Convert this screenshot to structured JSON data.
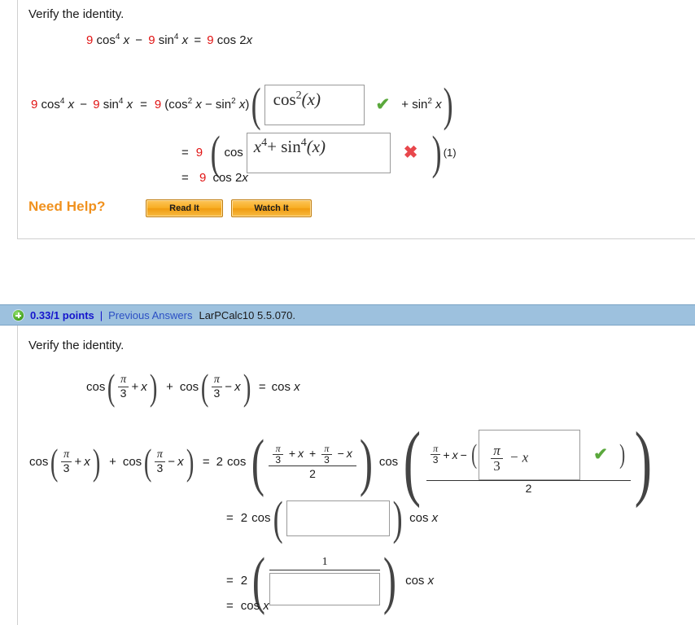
{
  "problem1": {
    "prompt": "Verify the identity.",
    "identity": {
      "coef": "9",
      "lhs_a": "cos",
      "lhs_a_sup": "4",
      "var": "x",
      "minus": "−",
      "lhs_b": "sin",
      "lhs_b_sup": "4",
      "eq": "=",
      "rhs_coef": "9",
      "rhs": "cos 2",
      "rhs_var": "x"
    },
    "line1": {
      "left": "9 cos⁴ x − 9 sin⁴ x",
      "eq": "=",
      "coef": "9",
      "factor": "(cos² x − sin² x)",
      "box_value": "cos",
      "box_sup": "2",
      "box_arg": "(x)",
      "mark": "✔",
      "mark_state": "correct",
      "tail": "+ sin² x"
    },
    "line2": {
      "eq": "=",
      "coef": "9",
      "cos_label": "cos",
      "box_var": "x",
      "box_sup1": "4",
      "box_plus": "+",
      "box_fn": "sin",
      "box_sup2": "4",
      "box_arg": "(x)",
      "mark": "✖",
      "mark_state": "incorrect",
      "tail": "(1)"
    },
    "line3": {
      "eq": "=",
      "coef": "9",
      "expr": "cos 2",
      "var": "x"
    },
    "need_help_label": "Need Help?",
    "buttons": [
      {
        "label": "Read It"
      },
      {
        "label": "Watch It"
      }
    ]
  },
  "statusbar": {
    "icon": "plus-circle-icon",
    "points": "0.33/1 points",
    "separator": "|",
    "previous_answers": "Previous Answers",
    "question_code": "LarPCalc10 5.5.070."
  },
  "problem2": {
    "prompt": "Verify the identity.",
    "identity": {
      "cos": "cos",
      "pi": "π",
      "three": "3",
      "plus": "+",
      "minus": "−",
      "var": "x",
      "eq": "=",
      "rhs": "cos x"
    },
    "work_line1": {
      "left_cos": "cos",
      "pi": "π",
      "three": "3",
      "plus": "+",
      "minus": "−",
      "var": "x",
      "eq": "=",
      "coef": "2",
      "cos": "cos",
      "frac1_num": "π/3 + x + π/3 − x",
      "frac1_den": "2",
      "frac2_den": "2",
      "box_pi": "π",
      "box_three": "3",
      "box_minus": "−",
      "box_var": "x",
      "mark": "✔",
      "mark_state": "correct"
    },
    "work_line2": {
      "eq": "=",
      "coef": "2",
      "cos": "cos",
      "box_value": "",
      "tail": "cos x"
    },
    "work_line3": {
      "eq": "=",
      "coef": "2",
      "num": "1",
      "box_value": "",
      "tail": "cos x"
    },
    "work_line4": {
      "eq": "=",
      "expr": "cos x"
    }
  },
  "colors": {
    "accent_red": "#e11414",
    "status_blue": "#9dc1de",
    "link_blue": "#2b4fc4",
    "points_blue": "#1515cc",
    "orange": "#f0911e",
    "check_green": "#5aa83c",
    "cross_red": "#e8474c"
  }
}
